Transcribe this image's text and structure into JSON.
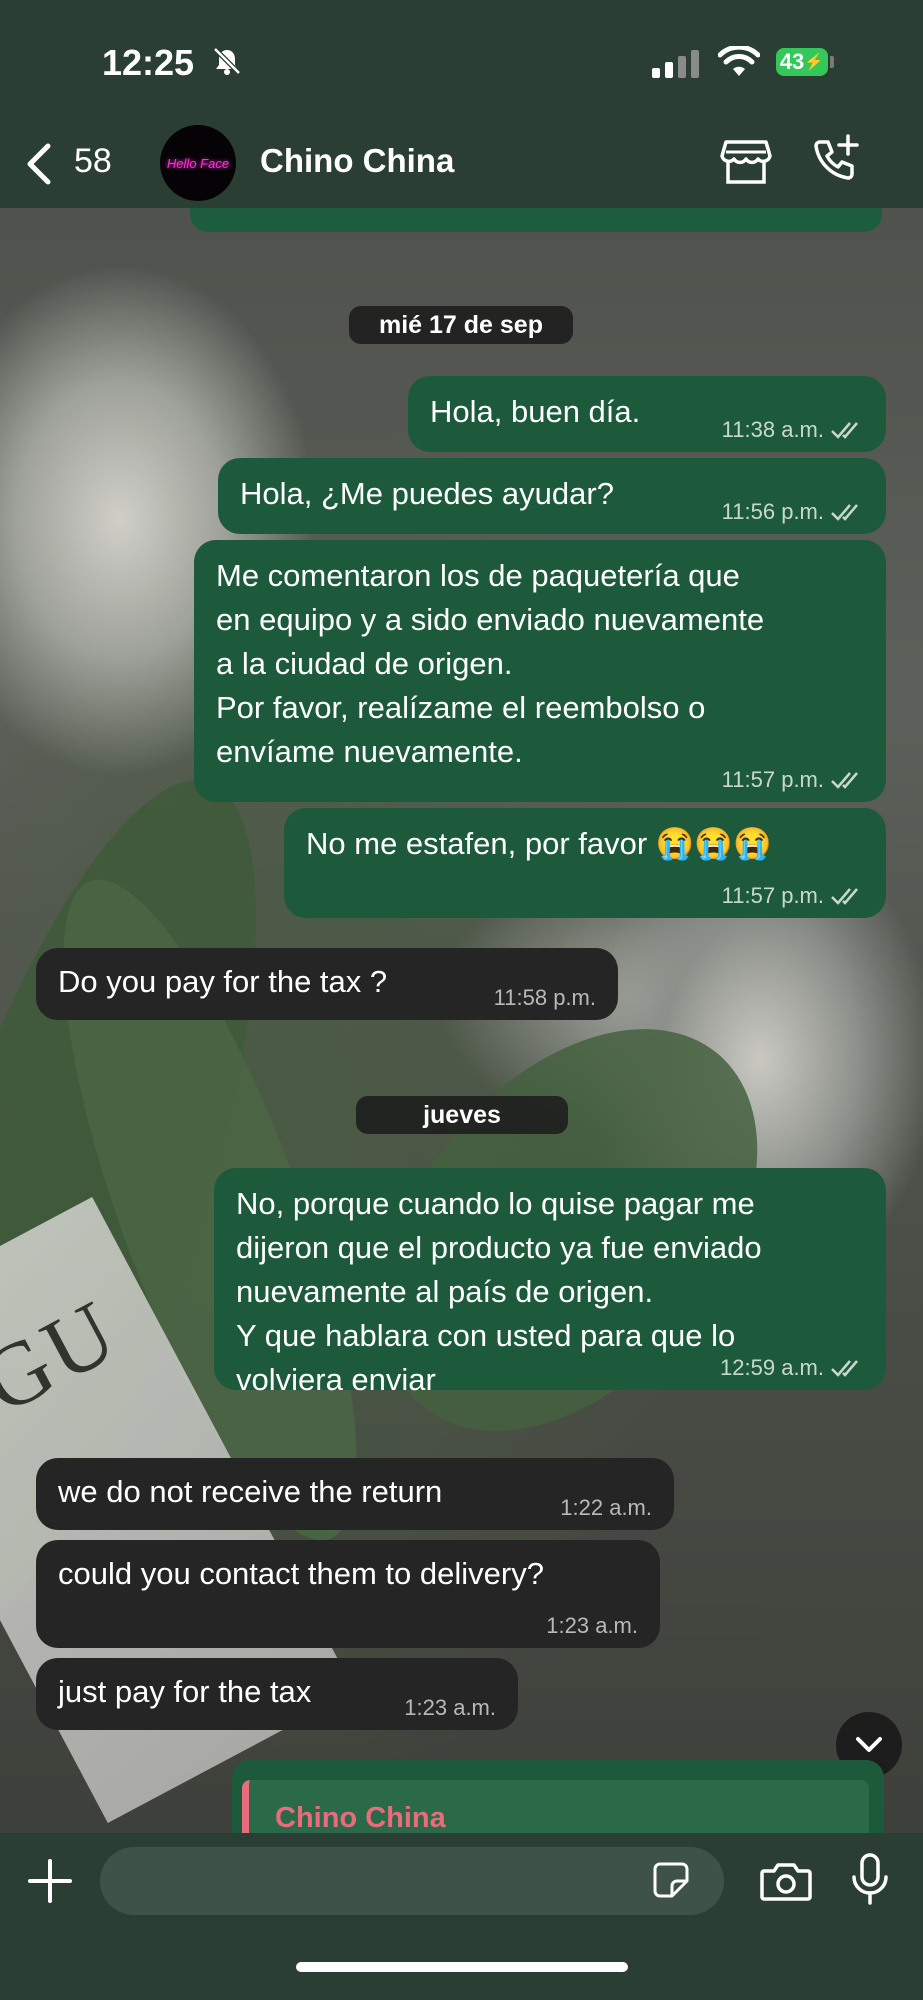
{
  "status_bar": {
    "time": "12:25",
    "battery": "43"
  },
  "header": {
    "back_count": "58",
    "avatar_text": "Hello Face",
    "contact_name": "Chino China"
  },
  "wallpaper": {
    "magazine_text": "OGU"
  },
  "chat": {
    "date_separators": [
      "mié 17 de sep",
      "jueves"
    ],
    "messages": [
      {
        "dir": "out",
        "text": "Hola, buen día.",
        "time": "11:38 a.m."
      },
      {
        "dir": "out",
        "text": "Hola, ¿Me puedes ayudar?",
        "time": "11:56 p.m."
      },
      {
        "dir": "out",
        "text": "Me comentaron los de paquetería que\nen equipo y a sido enviado nuevamente\na la ciudad de origen.\nPor favor, realízame el reembolso o\nenvíame nuevamente.",
        "time": "11:57 p.m."
      },
      {
        "dir": "out",
        "text": "No me estafen, por favor 😭😭😭",
        "time": "11:57 p.m."
      },
      {
        "dir": "in",
        "text": "Do you pay for the tax ?",
        "time": "11:58 p.m."
      },
      {
        "dir": "out",
        "text": "No, porque cuando lo quise pagar me\ndijeron que el producto ya fue enviado\nnuevamente al país de origen.\nY que hablara con usted para que lo\nvolviera enviar",
        "time": "12:59 a.m."
      },
      {
        "dir": "in",
        "text": "we do not receive the return",
        "time": "1:22 a.m."
      },
      {
        "dir": "in",
        "text": "could you contact them to delivery?",
        "time": "1:23 a.m."
      },
      {
        "dir": "in",
        "text": "just pay for the tax",
        "time": "1:23 a.m."
      }
    ],
    "reply_preview_name": "Chino China"
  },
  "colors": {
    "outgoing_bubble": "#1d5a3c",
    "incoming_bubble": "#252525",
    "bar": "#2b3e33",
    "reply_accent": "#ea6b7c"
  },
  "icons": [
    "bell-slash-icon",
    "signal-icon",
    "wifi-icon",
    "back-chevron-icon",
    "store-icon",
    "add-call-icon",
    "chevron-down-icon",
    "plus-icon",
    "sticker-icon",
    "camera-icon",
    "mic-icon",
    "double-check-icon"
  ]
}
